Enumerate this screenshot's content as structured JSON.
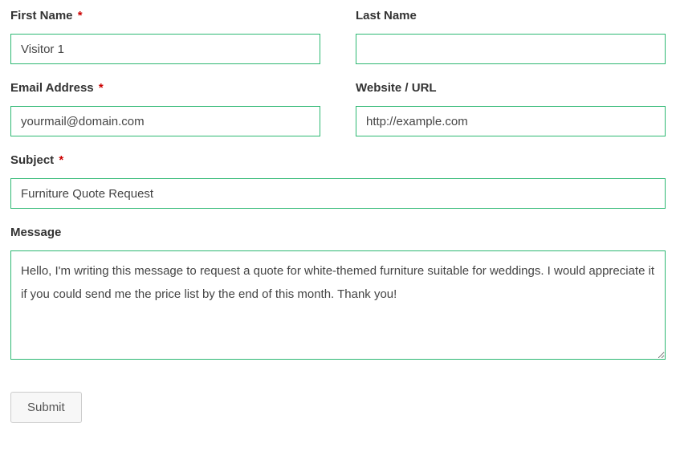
{
  "form": {
    "first_name": {
      "label": "First Name",
      "required": "*",
      "value": "Visitor 1"
    },
    "last_name": {
      "label": "Last Name",
      "value": ""
    },
    "email": {
      "label": "Email Address",
      "required": "*",
      "value": "yourmail@domain.com"
    },
    "website": {
      "label": "Website / URL",
      "value": "http://example.com"
    },
    "subject": {
      "label": "Subject",
      "required": "*",
      "value": "Furniture Quote Request"
    },
    "message": {
      "label": "Message",
      "value": "Hello, I'm writing this message to request a quote for white-themed furniture suitable for weddings. I would appreciate it if you could send me the price list by the end of this month. Thank you!"
    },
    "submit_label": "Submit"
  }
}
